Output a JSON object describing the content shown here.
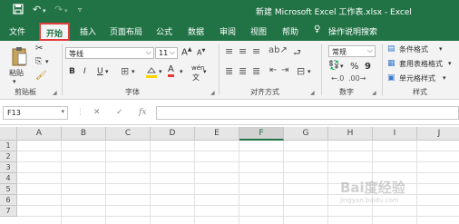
{
  "window": {
    "title": "新建 Microsoft Excel 工作表.xlsx  -  Excel"
  },
  "tabs": [
    {
      "label": "文件"
    },
    {
      "label": "开始"
    },
    {
      "label": "插入"
    },
    {
      "label": "页面布局"
    },
    {
      "label": "公式"
    },
    {
      "label": "数据"
    },
    {
      "label": "审阅"
    },
    {
      "label": "视图"
    },
    {
      "label": "帮助"
    }
  ],
  "tell_me": {
    "label": "操作说明搜索",
    "icon": "lightbulb-icon"
  },
  "ribbon": {
    "clipboard": {
      "label": "剪贴板",
      "paste": "粘贴"
    },
    "font": {
      "label": "字体",
      "font_name": "等线",
      "font_size": "11",
      "bold": "B",
      "italic": "I",
      "underline": "U",
      "increase": "A",
      "decrease": "A",
      "font_color_letter": "A",
      "phonetic": "wén"
    },
    "alignment": {
      "label": "对齐方式"
    },
    "number": {
      "label": "数字",
      "format": "常规",
      "percent": "%",
      "comma": "9"
    },
    "styles": {
      "label": "样式",
      "conditional": "条件格式",
      "table": "套用表格格式",
      "cell_styles": "单元格样式"
    }
  },
  "formula_bar": {
    "name_box": "F13",
    "cancel": "✕",
    "enter": "✓",
    "fx": "fx",
    "value": ""
  },
  "grid": {
    "columns": [
      "A",
      "B",
      "C",
      "D",
      "E",
      "F",
      "G",
      "H",
      "I",
      "J"
    ],
    "selected_column": "F",
    "rows": [
      "1",
      "2",
      "3",
      "4",
      "5",
      "6",
      "7"
    ]
  },
  "watermark": {
    "text": "Bai度经验",
    "sub": "jingyan.baidu.com"
  },
  "colors": {
    "accent": "#217346",
    "highlight_box": "#e23b3b",
    "pointer": "#e23b3b"
  }
}
